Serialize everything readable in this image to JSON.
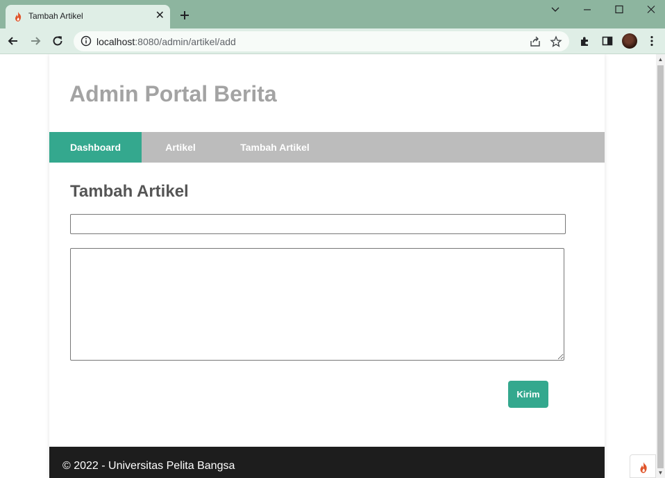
{
  "browser": {
    "tab": {
      "title": "Tambah Artikel",
      "favicon": "codeigniter-flame-icon"
    },
    "url": {
      "host": "localhost",
      "rest": ":8080/admin/artikel/add"
    }
  },
  "site": {
    "title": "Admin Portal Berita",
    "nav": [
      {
        "label": "Dashboard",
        "active": true
      },
      {
        "label": "Artikel",
        "active": false
      },
      {
        "label": "Tambah Artikel",
        "active": false
      }
    ]
  },
  "form": {
    "heading": "Tambah Artikel",
    "title_value": "",
    "content_value": "",
    "submit_label": "Kirim"
  },
  "footer": {
    "text": "© 2022 - Universitas Pelita Bangsa"
  },
  "colors": {
    "accent": "#34a88e",
    "nav_bg": "#bcbcbc",
    "footer_bg": "#1d1d1d",
    "site_title": "#a3a3a3",
    "tabstrip": "#8db59f"
  }
}
